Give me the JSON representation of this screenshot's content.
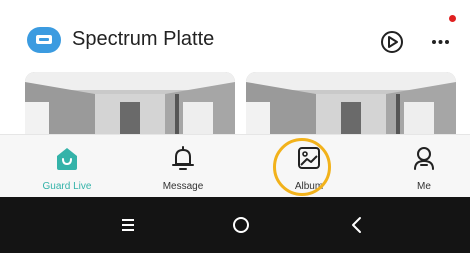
{
  "header": {
    "title": "Spectrum Platte",
    "device_icon": "device-icon",
    "play_icon": "play-icon",
    "more_icon": "more-dots-icon",
    "notification_color": "#e02020"
  },
  "cameras": [
    {
      "icon": "camera-preview"
    },
    {
      "icon": "camera-preview"
    }
  ],
  "nav": {
    "items": [
      {
        "label": "Guard Live",
        "icon": "guard-live-icon",
        "active": true
      },
      {
        "label": "Message",
        "icon": "bell-icon",
        "active": false
      },
      {
        "label": "Album",
        "icon": "album-icon",
        "active": false
      },
      {
        "label": "Me",
        "icon": "user-icon",
        "active": false
      }
    ],
    "active_color": "#34b3a9",
    "highlight_color": "#f2b21b"
  },
  "system_bar": {
    "buttons": [
      "menu-icon",
      "home-icon",
      "back-icon"
    ]
  }
}
